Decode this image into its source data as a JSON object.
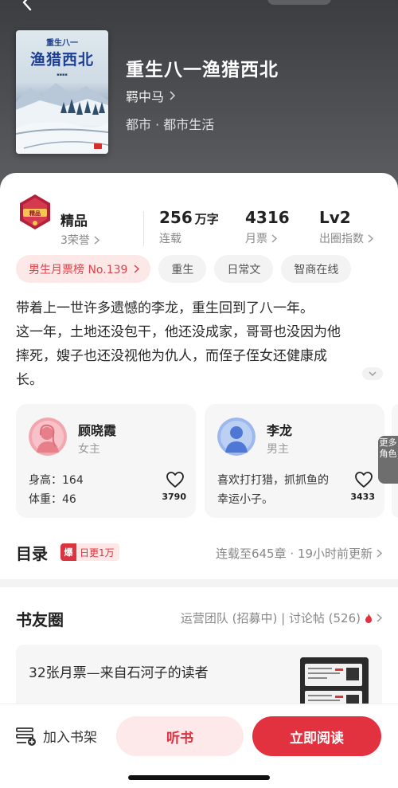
{
  "book": {
    "cover_subtitle": "重生八一",
    "cover_title": "渔猎西北",
    "title": "重生八一渔猎西北",
    "author": "羁中马",
    "genre": "都市 · 都市生活"
  },
  "stats": {
    "quality_label": "精品",
    "honor": "3荣誉",
    "words_value": "256",
    "words_unit": "万字",
    "words_label": "连载",
    "monthly_tickets": "4316",
    "monthly_tickets_label": "月票",
    "level": "Lv2",
    "level_label": "出圈指数"
  },
  "tags": [
    "男生月票榜 No.139",
    "重生",
    "日常文",
    "智商在线"
  ],
  "description": [
    "带着上一世许多遗憾的李龙，重生回到了八一年。",
    "这一年，土地还没包干，他还没成家，哥哥也没因为他",
    "摔死，嫂子也还没视他为仇人，而侄子侄女还健康成",
    "长。"
  ],
  "characters": [
    {
      "name": "顾晓霞",
      "role": "女主",
      "info_1": "身高：164",
      "info_2": "体重：46",
      "likes": "3790"
    },
    {
      "name": "李龙",
      "role": "男主",
      "info_1": "喜欢打打猎，抓抓鱼的",
      "info_2": "幸运小子。",
      "likes": "3433"
    }
  ],
  "more_roles": "更多角色",
  "toc": {
    "title": "目录",
    "badge_icon": "爆",
    "badge_text": "日更1万",
    "status": "连载至645章 · 19小时前更新"
  },
  "club": {
    "title": "书友圈",
    "meta": "运营团队 (招募中) | 讨论帖 (526)",
    "post_text": "32张月票—来自石河子的读者"
  },
  "bottom_bar": {
    "shelf_label": "加入书架",
    "listen_label": "听书",
    "read_label": "立即阅读"
  },
  "colors": {
    "accent": "#e3323f",
    "accent_soft": "#fde9ea",
    "header_bg": "#45474b"
  }
}
